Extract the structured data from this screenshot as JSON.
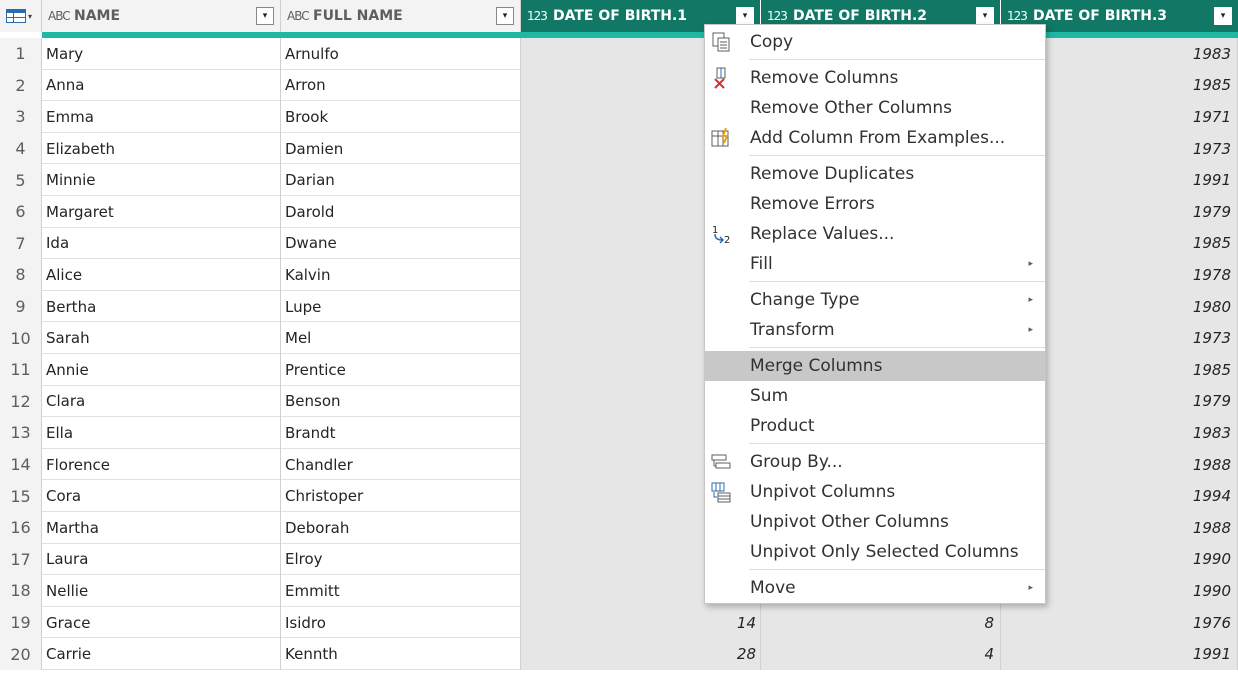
{
  "columns": [
    {
      "type_icon": "ABC",
      "label": "NAME",
      "dropdown": "▾"
    },
    {
      "type_icon": "ABC",
      "label": "FULL NAME",
      "dropdown": "▾"
    },
    {
      "type_icon": "123",
      "label": "DATE OF BIRTH.1",
      "dropdown": "▾"
    },
    {
      "type_icon": "123",
      "label": "DATE OF BIRTH.2",
      "dropdown": "▾"
    },
    {
      "type_icon": "123",
      "label": "DATE OF BIRTH.3",
      "dropdown": "▾"
    }
  ],
  "rows": [
    {
      "idx": "1",
      "name": "Mary",
      "full": "Arnulfo",
      "d1": "",
      "d2": "",
      "d3": "1983"
    },
    {
      "idx": "2",
      "name": "Anna",
      "full": "Arron",
      "d1": "",
      "d2": "",
      "d3": "1985"
    },
    {
      "idx": "3",
      "name": "Emma",
      "full": "Brook",
      "d1": "",
      "d2": "",
      "d3": "1971"
    },
    {
      "idx": "4",
      "name": "Elizabeth",
      "full": "Damien",
      "d1": "",
      "d2": "",
      "d3": "1973"
    },
    {
      "idx": "5",
      "name": "Minnie",
      "full": "Darian",
      "d1": "",
      "d2": "",
      "d3": "1991"
    },
    {
      "idx": "6",
      "name": "Margaret",
      "full": "Darold",
      "d1": "",
      "d2": "",
      "d3": "1979"
    },
    {
      "idx": "7",
      "name": "Ida",
      "full": "Dwane",
      "d1": "",
      "d2": "",
      "d3": "1985"
    },
    {
      "idx": "8",
      "name": "Alice",
      "full": "Kalvin",
      "d1": "",
      "d2": "",
      "d3": "1978"
    },
    {
      "idx": "9",
      "name": "Bertha",
      "full": "Lupe",
      "d1": "",
      "d2": "",
      "d3": "1980"
    },
    {
      "idx": "10",
      "name": "Sarah",
      "full": "Mel",
      "d1": "",
      "d2": "",
      "d3": "1973"
    },
    {
      "idx": "11",
      "name": "Annie",
      "full": "Prentice",
      "d1": "",
      "d2": "",
      "d3": "1985"
    },
    {
      "idx": "12",
      "name": "Clara",
      "full": "Benson",
      "d1": "",
      "d2": "",
      "d3": "1979"
    },
    {
      "idx": "13",
      "name": "Ella",
      "full": "Brandt",
      "d1": "",
      "d2": "",
      "d3": "1983"
    },
    {
      "idx": "14",
      "name": "Florence",
      "full": "Chandler",
      "d1": "",
      "d2": "",
      "d3": "1988"
    },
    {
      "idx": "15",
      "name": "Cora",
      "full": "Christoper",
      "d1": "",
      "d2": "",
      "d3": "1994"
    },
    {
      "idx": "16",
      "name": "Martha",
      "full": "Deborah",
      "d1": "",
      "d2": "",
      "d3": "1988"
    },
    {
      "idx": "17",
      "name": "Laura",
      "full": "Elroy",
      "d1": "",
      "d2": "",
      "d3": "1990"
    },
    {
      "idx": "18",
      "name": "Nellie",
      "full": "Emmitt",
      "d1": "",
      "d2": "",
      "d3": "1990"
    },
    {
      "idx": "19",
      "name": "Grace",
      "full": "Isidro",
      "d1": "14",
      "d2": "8",
      "d3": "1976"
    },
    {
      "idx": "20",
      "name": "Carrie",
      "full": "Kennth",
      "d1": "28",
      "d2": "4",
      "d3": "1991"
    }
  ],
  "menu": {
    "items": [
      {
        "label": "Copy",
        "icon": "copy-icon",
        "submenu": false,
        "highlighted": false
      },
      {
        "label": "Remove Columns",
        "icon": "remove-columns-icon",
        "submenu": false,
        "highlighted": false
      },
      {
        "label": "Remove Other Columns",
        "icon": "",
        "submenu": false,
        "highlighted": false
      },
      {
        "label": "Add Column From Examples...",
        "icon": "add-column-examples-icon",
        "submenu": false,
        "highlighted": false
      },
      {
        "label": "Remove Duplicates",
        "icon": "",
        "submenu": false,
        "highlighted": false
      },
      {
        "label": "Remove Errors",
        "icon": "",
        "submenu": false,
        "highlighted": false
      },
      {
        "label": "Replace Values...",
        "icon": "replace-values-icon",
        "submenu": false,
        "highlighted": false
      },
      {
        "label": "Fill",
        "icon": "",
        "submenu": true,
        "highlighted": false
      },
      {
        "label": "Change Type",
        "icon": "",
        "submenu": true,
        "highlighted": false
      },
      {
        "label": "Transform",
        "icon": "",
        "submenu": true,
        "highlighted": false
      },
      {
        "label": "Merge Columns",
        "icon": "",
        "submenu": false,
        "highlighted": true
      },
      {
        "label": "Sum",
        "icon": "",
        "submenu": false,
        "highlighted": false
      },
      {
        "label": "Product",
        "icon": "",
        "submenu": false,
        "highlighted": false
      },
      {
        "label": "Group By...",
        "icon": "group-by-icon",
        "submenu": false,
        "highlighted": false
      },
      {
        "label": "Unpivot Columns",
        "icon": "unpivot-columns-icon",
        "submenu": false,
        "highlighted": false
      },
      {
        "label": "Unpivot Other Columns",
        "icon": "",
        "submenu": false,
        "highlighted": false
      },
      {
        "label": "Unpivot Only Selected Columns",
        "icon": "",
        "submenu": false,
        "highlighted": false
      },
      {
        "label": "Move",
        "icon": "",
        "submenu": true,
        "highlighted": false
      }
    ],
    "submenu_glyph": "▸"
  },
  "colors": {
    "selected_header": "#117865",
    "quality_bar": "#1fb8a5",
    "selected_column_bg": "#e6e6e6",
    "menu_highlight": "#c8c8c8"
  }
}
